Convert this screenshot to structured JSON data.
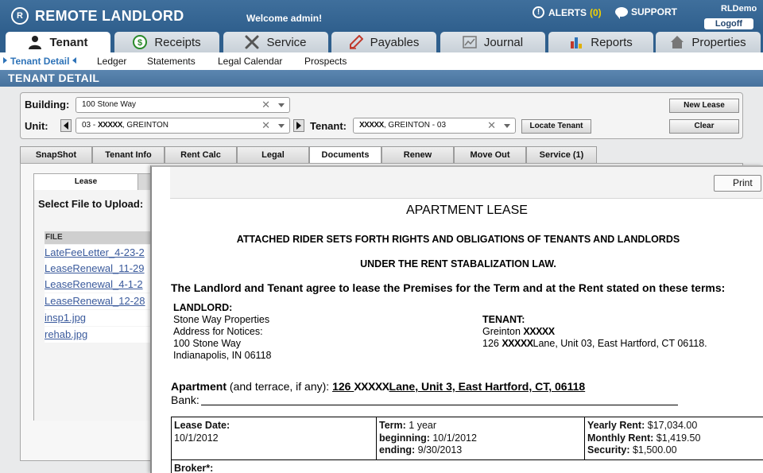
{
  "header": {
    "logo_text": "REMOTE LANDLORD",
    "logo_mark": "R",
    "welcome": "Welcome admin!",
    "alerts_label": "ALERTS",
    "alerts_count": "(0)",
    "support_label": "SUPPORT",
    "user_name": "RLDemo",
    "logoff_label": "Logoff"
  },
  "main_tabs": [
    {
      "label": "Tenant",
      "icon": "person-icon"
    },
    {
      "label": "Receipts",
      "icon": "dollar-icon"
    },
    {
      "label": "Service",
      "icon": "tools-icon"
    },
    {
      "label": "Payables",
      "icon": "pen-icon"
    },
    {
      "label": "Journal",
      "icon": "chart-icon"
    },
    {
      "label": "Reports",
      "icon": "bar-chart-icon"
    },
    {
      "label": "Properties",
      "icon": "house-icon"
    }
  ],
  "subnav": [
    {
      "label": "Tenant Detail"
    },
    {
      "label": "Ledger"
    },
    {
      "label": "Statements"
    },
    {
      "label": "Legal Calendar"
    },
    {
      "label": "Prospects"
    }
  ],
  "page_title": "TENANT DETAIL",
  "search": {
    "building_label": "Building:",
    "building_value": "100 Stone Way",
    "unit_label": "Unit:",
    "unit_value_prefix": "03 - ",
    "unit_value_redacted": "XXXXX",
    "unit_value_suffix": ", GREINTON",
    "tenant_label": "Tenant:",
    "tenant_value_redacted": "XXXXX",
    "tenant_value_suffix": ", GREINTON - 03",
    "clear_glyph": "✕",
    "locate_label": "Locate Tenant",
    "new_lease_label": "New Lease",
    "clear_label": "Clear"
  },
  "detail_tabs": [
    {
      "label": "SnapShot"
    },
    {
      "label": "Tenant Info"
    },
    {
      "label": "Rent Calc"
    },
    {
      "label": "Legal"
    },
    {
      "label": "Documents"
    },
    {
      "label": "Renew"
    },
    {
      "label": "Move Out"
    },
    {
      "label": "Service (1)"
    }
  ],
  "documents": {
    "tab_label": "Lease",
    "select_label": "Select File to Upload:",
    "file_header": "FILE",
    "files": [
      "LateFeeLetter_4-23-2",
      "LeaseRenewal_11-29",
      "LeaseRenewal_4-1-2",
      "LeaseRenewal_12-28",
      "insp1.jpg",
      "rehab.jpg"
    ]
  },
  "lease": {
    "print_label": "Print",
    "title": "APARTMENT LEASE",
    "subtitle_1": "ATTACHED RIDER SETS FORTH RIGHTS AND OBLIGATIONS OF TENANTS AND LANDLORDS",
    "subtitle_2": "UNDER THE RENT STABALIZATION LAW.",
    "intro": "The Landlord and Tenant agree to lease the Premises for the Term and at the Rent stated on these terms:",
    "landlord_heading": "LANDLORD:",
    "landlord_name": "Stone Way Properties",
    "landlord_notice_label": "Address for Notices:",
    "landlord_street": "100 Stone Way",
    "landlord_city": "Indianapolis, IN 06118",
    "tenant_heading": "TENANT:",
    "tenant_name_prefix": "Greinton ",
    "tenant_name_redacted": "XXXXX",
    "tenant_addr_prefix": "126 ",
    "tenant_addr_redacted": "XXXXX",
    "tenant_addr_suffix": "Lane, Unit 03, East Hartford, CT 06118.",
    "apartment_label": "Apartment",
    "apartment_paren": " (and terrace, if any): ",
    "apartment_prefix": "126 ",
    "apartment_redacted": "XXXXX",
    "apartment_suffix": "Lane, Unit 3, East Hartford, CT, 06118",
    "bank_label": "Bank:",
    "lease_date_label": "Lease Date:",
    "lease_date": "10/1/2012",
    "term_label": "Term:",
    "term_value": " 1 year",
    "beginning_label": "beginning:",
    "beginning_value": " 10/1/2012",
    "ending_label": "ending:",
    "ending_value": " 9/30/2013",
    "yearly_label": "Yearly Rent:",
    "yearly_value": " $17,034.00",
    "monthly_label": "Monthly Rent:",
    "monthly_value": " $1,419.50",
    "security_label": "Security:",
    "security_value": " $1,500.00",
    "broker_label": "Broker*:"
  }
}
